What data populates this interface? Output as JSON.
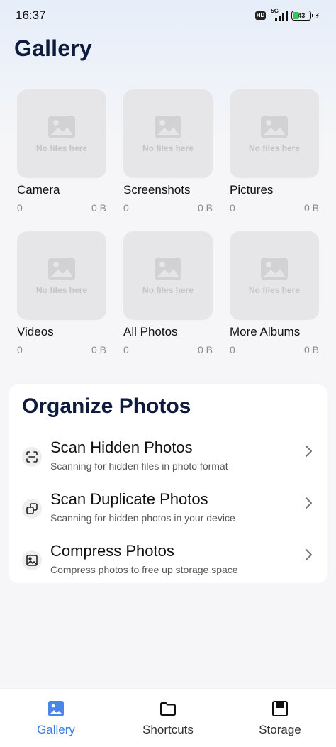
{
  "status_bar": {
    "time": "16:37",
    "hd": "HD",
    "network": "5G",
    "battery": "43",
    "battery_level": 0.43
  },
  "page_title": "Gallery",
  "albums": [
    {
      "name": "Camera",
      "count": "0",
      "size": "0 B",
      "placeholder": "No files here"
    },
    {
      "name": "Screenshots",
      "count": "0",
      "size": "0 B",
      "placeholder": "No files here"
    },
    {
      "name": "Pictures",
      "count": "0",
      "size": "0 B",
      "placeholder": "No files here"
    },
    {
      "name": "Videos",
      "count": "0",
      "size": "0 B",
      "placeholder": "No files here"
    },
    {
      "name": "All Photos",
      "count": "0",
      "size": "0 B",
      "placeholder": "No files here"
    },
    {
      "name": "More Albums",
      "count": "0",
      "size": "0 B",
      "placeholder": "No files here"
    }
  ],
  "organize": {
    "title": "Organize Photos",
    "items": [
      {
        "title": "Scan Hidden Photos",
        "subtitle": "Scanning for hidden files in photo format",
        "icon": "scan-icon"
      },
      {
        "title": "Scan Duplicate Photos",
        "subtitle": "Scanning for hidden photos in your device",
        "icon": "duplicate-icon"
      },
      {
        "title": "Compress Photos",
        "subtitle": "Compress photos to free up storage space",
        "icon": "compress-icon"
      }
    ]
  },
  "bottom_nav": {
    "tabs": [
      {
        "label": "Gallery",
        "icon": "gallery-icon",
        "active": true
      },
      {
        "label": "Shortcuts",
        "icon": "folder-icon",
        "active": false
      },
      {
        "label": "Storage",
        "icon": "storage-icon",
        "active": false
      }
    ]
  },
  "colors": {
    "accent": "#3f7be0",
    "title": "#0f1b3d",
    "placeholder_bg": "#e6e6e8",
    "battery_green": "#34c759"
  }
}
